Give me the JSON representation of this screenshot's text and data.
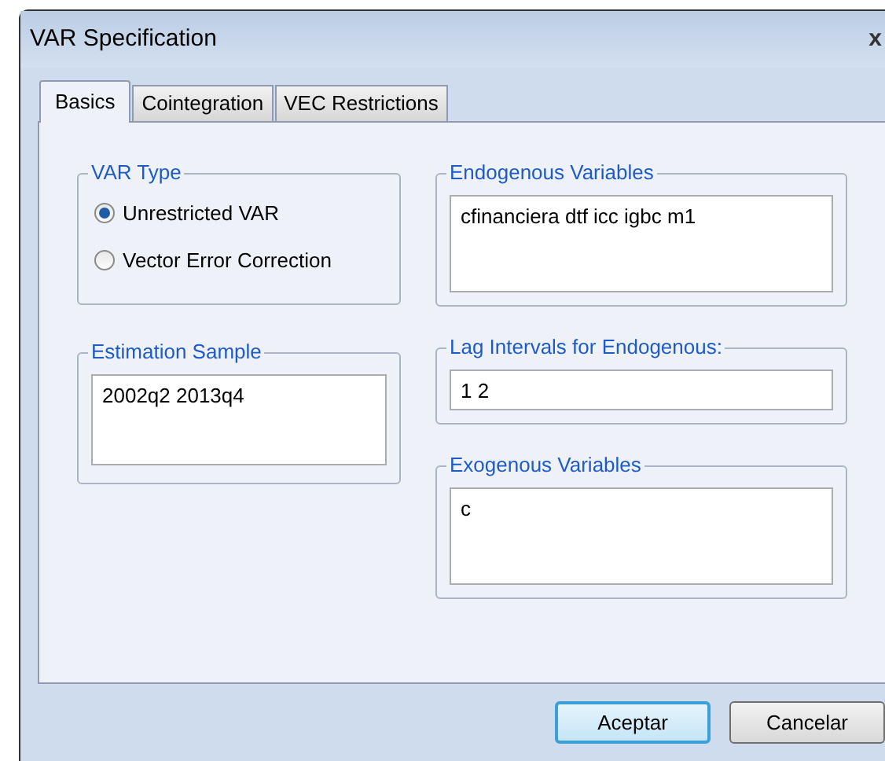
{
  "window": {
    "title": "VAR Specification",
    "close": "x"
  },
  "tabs": [
    {
      "label": "Basics",
      "selected": true
    },
    {
      "label": "Cointegration",
      "selected": false
    },
    {
      "label": "VEC Restrictions",
      "selected": false
    }
  ],
  "var_type": {
    "title": "VAR Type",
    "options": [
      {
        "label": "Unrestricted VAR",
        "selected": true
      },
      {
        "label": "Vector Error Correction",
        "selected": false
      }
    ]
  },
  "estimation_sample": {
    "title": "Estimation Sample",
    "value": "2002q2 2013q4"
  },
  "endogenous_variables": {
    "title": "Endogenous Variables",
    "value": "cfinanciera dtf icc igbc m1"
  },
  "lag_intervals": {
    "title": "Lag Intervals for Endogenous:",
    "value": "1 2"
  },
  "exogenous_variables": {
    "title": "Exogenous Variables",
    "value": "c"
  },
  "buttons": [
    {
      "label": "Aceptar",
      "default": true
    },
    {
      "label": "Cancelar",
      "default": false
    }
  ]
}
